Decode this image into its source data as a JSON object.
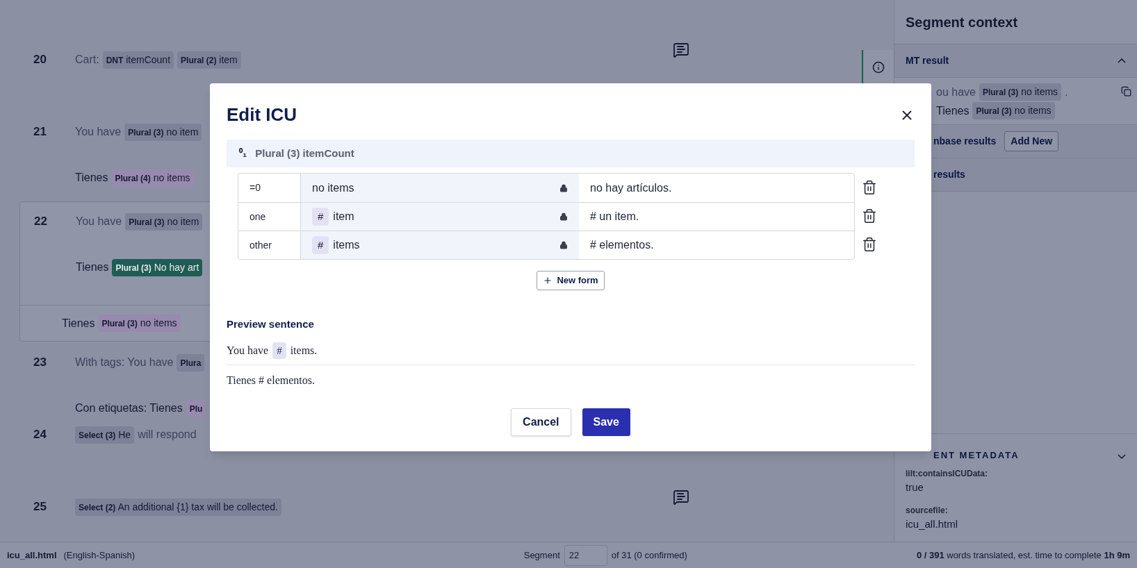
{
  "segments": [
    {
      "number": "20",
      "selected": false,
      "comment": true,
      "source": [
        {
          "kind": "text",
          "text": "Cart:"
        },
        {
          "kind": "tag",
          "label": "DNT",
          "text": "itemCount",
          "color": "#7d8299"
        },
        {
          "kind": "tag",
          "label": "Plural (2)",
          "text": "item",
          "color": "#7d8299"
        }
      ]
    },
    {
      "number": "21",
      "selected": false,
      "source": [
        {
          "kind": "text",
          "text": "You have"
        },
        {
          "kind": "tag",
          "label": "Plural (3)",
          "text": "no item",
          "color": "#7d8299"
        }
      ],
      "target": [
        {
          "kind": "text",
          "text": "Tienes"
        },
        {
          "kind": "tag",
          "label": "Plural (4)",
          "text": "no items",
          "color": "#978aae"
        }
      ]
    },
    {
      "number": "22",
      "selected": true,
      "source": [
        {
          "kind": "text",
          "text": "You have"
        },
        {
          "kind": "tag",
          "label": "Plural (3)",
          "text": "no item",
          "color": "#7d8299"
        }
      ],
      "target": [
        {
          "kind": "text",
          "text": "Tienes"
        },
        {
          "kind": "tag",
          "label": "Plural (3)",
          "text": "No hay art",
          "color": "#1f5d52"
        }
      ],
      "alternative": [
        {
          "kind": "text",
          "text": "Tienes"
        },
        {
          "kind": "tag",
          "label": "Plural (3)",
          "text": "no items",
          "color": "#978aae"
        }
      ]
    },
    {
      "number": "23",
      "selected": false,
      "source": [
        {
          "kind": "text",
          "text": "With tags: You have"
        },
        {
          "kind": "tag",
          "label": "Plura",
          "color": "#7d8299"
        }
      ],
      "target": [
        {
          "kind": "text",
          "text": "Con etiquetas: Tienes"
        },
        {
          "kind": "tag",
          "label": "Plu",
          "color": "#978aae"
        }
      ]
    },
    {
      "number": "24",
      "selected": false,
      "source": [
        {
          "kind": "tag",
          "label": "Select (3)",
          "text": "He",
          "color": "#7d8299"
        },
        {
          "kind": "text",
          "text": "will respond"
        }
      ]
    },
    {
      "number": "25",
      "selected": false,
      "comment": true,
      "source": [
        {
          "kind": "tag",
          "label": "Select (2)",
          "text": "An additional {1} tax will be collected.",
          "color": "#7d8299"
        }
      ]
    }
  ],
  "context": {
    "title": "Segment context",
    "mt": {
      "title": "MT result",
      "expanded": true,
      "source": [
        {
          "kind": "text",
          "text": "ou have"
        },
        {
          "kind": "tag",
          "label": "Plural (3)",
          "text": "no items",
          "color": "#7d8299"
        },
        {
          "kind": "text",
          "text": "."
        }
      ],
      "target": [
        {
          "kind": "text",
          "text": "Tienes"
        },
        {
          "kind": "tag",
          "label": "Plural (3)",
          "text": "no items",
          "color": "#7d8299"
        }
      ]
    },
    "termbase": {
      "title": "nbase results",
      "button": "Add New"
    },
    "tm": {
      "title": "results"
    },
    "metadata": {
      "title": "ENT METADATA",
      "expanded": false,
      "fields": [
        {
          "key": "lilt:containsICUData:",
          "value": "true"
        },
        {
          "key": "sourcefile:",
          "value": "icu_all.html"
        }
      ]
    }
  },
  "status_bar": {
    "file": "icu_all.html",
    "languages": "(English-Spanish)",
    "segment_label": "Segment",
    "segment_value": "22",
    "segment_total": "of 31 (0 confirmed)",
    "progress": "**0 / 391** words translated, est. time to complete **1h 9m**"
  },
  "dialog": {
    "title": "Edit ICU",
    "header": {
      "symbol": "⁰₁",
      "label": "Plural (3) itemCount"
    },
    "forms": [
      {
        "category": "=0",
        "source": [
          {
            "kind": "text",
            "text": "no items"
          }
        ],
        "target": "no hay artículos."
      },
      {
        "category": "one",
        "source": [
          {
            "kind": "tag",
            "label": "#"
          },
          {
            "kind": "text",
            "text": "item"
          }
        ],
        "target": "# un item."
      },
      {
        "category": "other",
        "source": [
          {
            "kind": "tag",
            "label": "#"
          },
          {
            "kind": "text",
            "text": "items"
          }
        ],
        "target": "# elementos."
      }
    ],
    "new_form": "New form",
    "preview": {
      "title": "Preview sentence",
      "source": [
        {
          "kind": "text",
          "text": "You have"
        },
        {
          "kind": "tag",
          "label": "#"
        },
        {
          "kind": "text",
          "text": "items."
        }
      ],
      "target": "Tienes # elementos."
    },
    "buttons": [
      {
        "label": "Cancel",
        "kind": "secondary"
      },
      {
        "label": "Save",
        "kind": "primary"
      }
    ]
  }
}
